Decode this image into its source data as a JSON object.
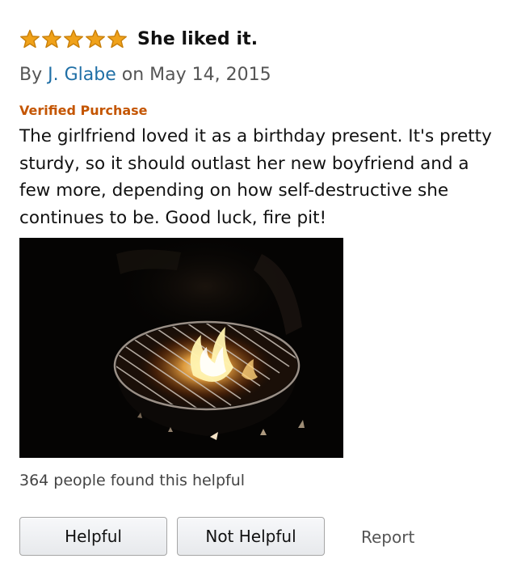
{
  "review": {
    "rating": 5,
    "rating_max": 5,
    "title": "She liked it.",
    "byline_prefix": "By ",
    "author": "J. Glabe",
    "date_text": " on May 14, 2015",
    "verified_label": "Verified Purchase",
    "body": "The girlfriend loved it as a birthday present. It's pretty sturdy, so it should outlast her new boyfriend and a few more, depending on how self-destructive she continues to be. Good luck, fire pit!",
    "photo_icon": "fire-pit-photo",
    "helpful_count_text": "364 people found this helpful"
  },
  "actions": {
    "helpful_label": "Helpful",
    "not_helpful_label": "Not Helpful",
    "report_label": "Report"
  },
  "colors": {
    "star_fill": "#f0a21a",
    "star_stroke": "#c87f0a",
    "author_link": "#1f6fa6",
    "verified": "#c45500"
  }
}
